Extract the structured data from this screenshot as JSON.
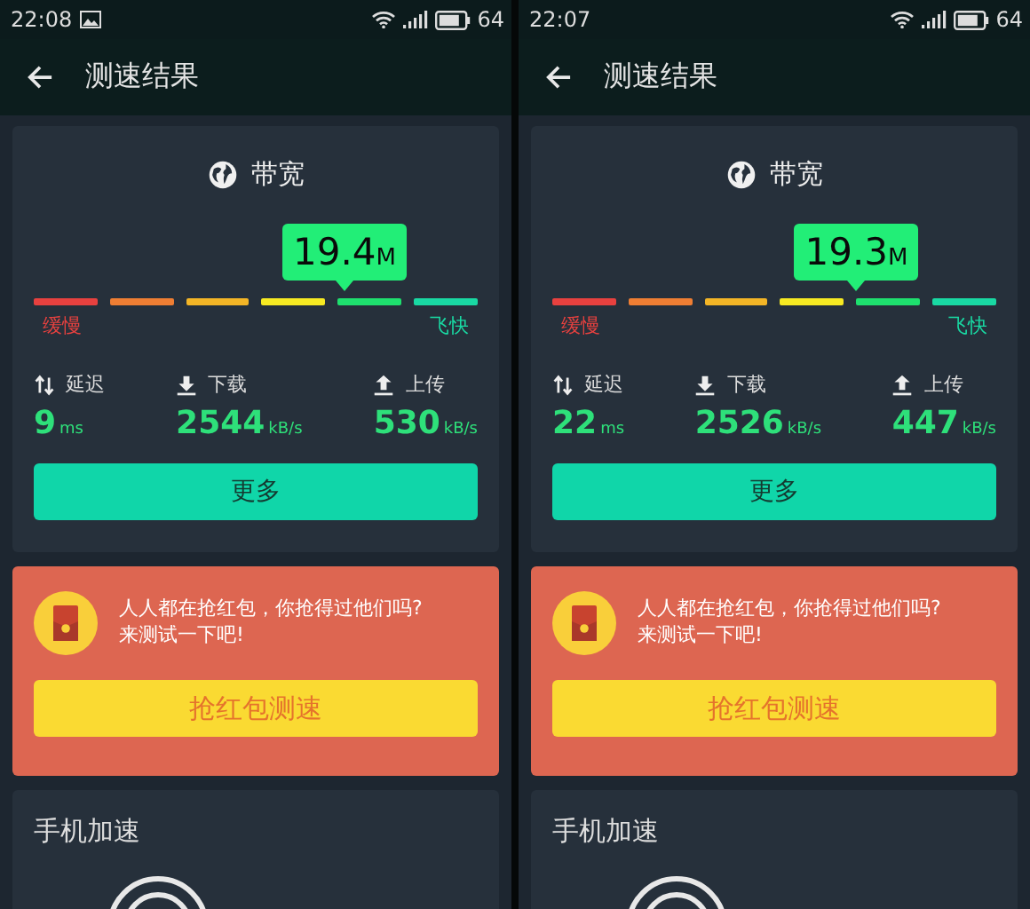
{
  "screens": [
    {
      "status_bar": {
        "time": "22:08",
        "picture_notification": true,
        "battery": "64"
      },
      "title": "测速结果",
      "bandwidth": {
        "title": "带宽",
        "value": "19.4",
        "unit": "M",
        "level": 0.7,
        "slow_label": "缓慢",
        "fast_label": "飞快",
        "segments": [
          {
            "color": "#e8413f"
          },
          {
            "color": "#ef7e33"
          },
          {
            "color": "#f3b526"
          },
          {
            "color": "#f7ea22"
          },
          {
            "color": "#1ee06e"
          },
          {
            "color": "#19d9a3"
          }
        ]
      },
      "stats": [
        {
          "kind": "latency",
          "label": "延迟",
          "value": "9",
          "unit": "ms"
        },
        {
          "kind": "download",
          "label": "下载",
          "value": "2544",
          "unit": "kB/s"
        },
        {
          "kind": "upload",
          "label": "上传",
          "value": "530",
          "unit": "kB/s"
        }
      ],
      "more_button": "更多",
      "promo": {
        "text": "人人都在抢红包，你抢得过他们吗?\n来测试一下吧!",
        "button": "抢红包测速"
      },
      "boost": {
        "title": "手机加速"
      }
    },
    {
      "status_bar": {
        "time": "22:07",
        "picture_notification": false,
        "battery": "64"
      },
      "title": "测速结果",
      "bandwidth": {
        "title": "带宽",
        "value": "19.3",
        "unit": "M",
        "level": 0.685,
        "slow_label": "缓慢",
        "fast_label": "飞快",
        "segments": [
          {
            "color": "#e8413f"
          },
          {
            "color": "#ef7e33"
          },
          {
            "color": "#f3b526"
          },
          {
            "color": "#f7ea22"
          },
          {
            "color": "#1ee06e"
          },
          {
            "color": "#19d9a3"
          }
        ]
      },
      "stats": [
        {
          "kind": "latency",
          "label": "延迟",
          "value": "22",
          "unit": "ms"
        },
        {
          "kind": "download",
          "label": "下载",
          "value": "2526",
          "unit": "kB/s"
        },
        {
          "kind": "upload",
          "label": "上传",
          "value": "447",
          "unit": "kB/s"
        }
      ],
      "more_button": "更多",
      "promo": {
        "text": "人人都在抢红包，你抢得过他们吗?\n来测试一下吧!",
        "button": "抢红包测速"
      },
      "boost": {
        "title": "手机加速"
      }
    }
  ]
}
